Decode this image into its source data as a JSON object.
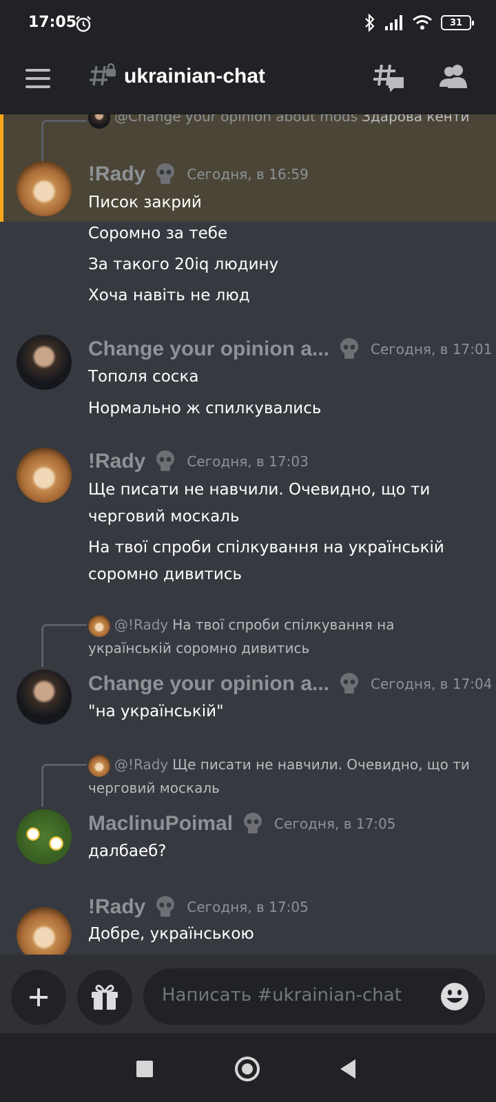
{
  "status_bar": {
    "time": "17:05",
    "battery": "31"
  },
  "header": {
    "channel_name": "ukrainian-chat"
  },
  "messages": [
    {
      "reply_to": {
        "mention": "@Change your opinion about mods",
        "text": "Здарова кенти"
      },
      "username": "!Rady",
      "timestamp": "Сегодня, в 16:59",
      "lines": [
        "Писок закрий",
        "Соромно за тебе",
        "За такого 20iq людину",
        "Хоча навіть не люд"
      ]
    },
    {
      "username": "Change your opinion a...",
      "timestamp": "Сегодня, в 17:01",
      "lines": [
        "Тополя соска",
        "Нормально ж спилкувались"
      ]
    },
    {
      "username": "!Rady",
      "timestamp": "Сегодня, в 17:03",
      "lines": [
        "Ще писати не навчили. Очевидно, що ти черговий москаль",
        "На твої спроби спілкування на українській соромно дивитись"
      ]
    },
    {
      "reply_to": {
        "mention": "@!Rady",
        "text": "На твої спроби спілкування на українській соромно дивитись"
      },
      "username": "Change your opinion a...",
      "timestamp": "Сегодня, в 17:04",
      "lines": [
        "\"на українській\""
      ]
    },
    {
      "reply_to": {
        "mention": "@!Rady",
        "text": "Ще писати не навчили. Очевидно, що ти черговий москаль"
      },
      "username": "MaclinuPoimal",
      "timestamp": "Сегодня, в 17:05",
      "lines": [
        "далбаеб?"
      ]
    },
    {
      "username": "!Rady",
      "timestamp": "Сегодня, в 17:05",
      "lines": [
        "Добре, українською"
      ]
    }
  ],
  "composer": {
    "placeholder": "Написать #ukrainian-chat"
  },
  "icons": {
    "menu": "hamburger-icon",
    "channel": "locked-hash-icon",
    "threads": "threads-icon",
    "members": "members-icon",
    "add": "plus-icon",
    "gift": "gift-icon",
    "emoji": "emoji-icon",
    "alarm": "alarm-icon",
    "bluetooth": "bluetooth-icon",
    "signal": "signal-icon",
    "wifi": "wifi-icon"
  },
  "colors": {
    "background": "#36393f",
    "highlight": "#4a4536",
    "highlight_border": "#faa81a",
    "bars": "#202225"
  }
}
